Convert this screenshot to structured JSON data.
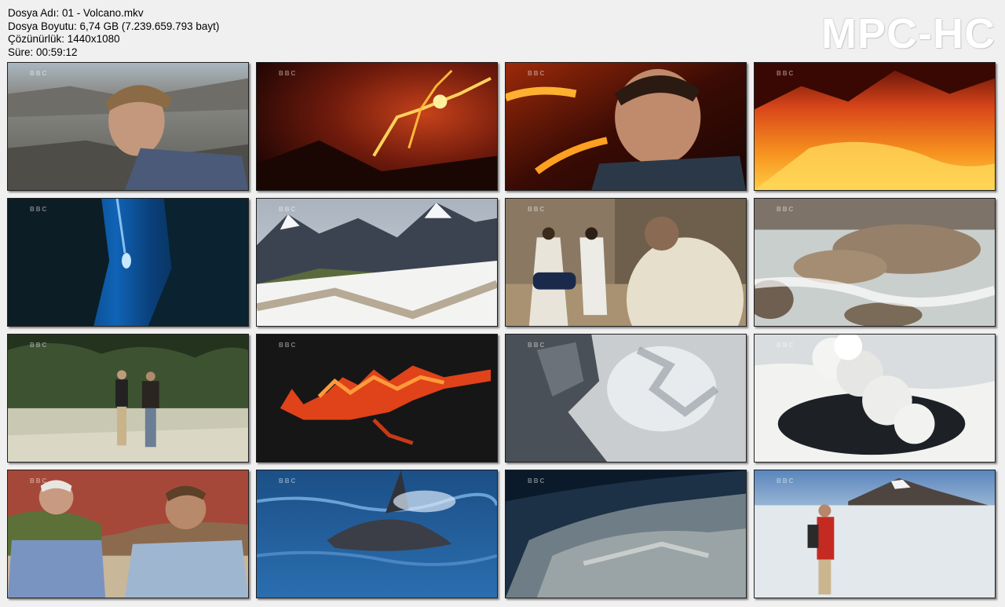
{
  "file_info": {
    "name_line": "Dosya Adı: 01 - Volcano.mkv",
    "size_line": "Dosya Boyutu: 6,74 GB (7.239.659.793 bayt)",
    "resolution_line": "Çözünürlük: 1440x1080",
    "duration_line": "Süre: 00:59:12"
  },
  "logo": "MPC-HC",
  "watermark": "BBC",
  "thumbnails": [
    {
      "id": 1,
      "scene": "man-on-rocks"
    },
    {
      "id": 2,
      "scene": "lava-cracks"
    },
    {
      "id": 3,
      "scene": "man-before-lava"
    },
    {
      "id": 4,
      "scene": "lava-lake"
    },
    {
      "id": 5,
      "scene": "diver-in-rift"
    },
    {
      "id": 6,
      "scene": "snowy-mountains"
    },
    {
      "id": 7,
      "scene": "men-running"
    },
    {
      "id": 8,
      "scene": "river-rocks"
    },
    {
      "id": 9,
      "scene": "men-walking-by-lake"
    },
    {
      "id": 10,
      "scene": "lava-fire-night"
    },
    {
      "id": 11,
      "scene": "rock-and-ice"
    },
    {
      "id": 12,
      "scene": "eruption-plume"
    },
    {
      "id": 13,
      "scene": "two-men-talking"
    },
    {
      "id": 14,
      "scene": "dolphin-in-sea"
    },
    {
      "id": 15,
      "scene": "underwater-rock"
    },
    {
      "id": 16,
      "scene": "hiker-in-snow"
    }
  ]
}
